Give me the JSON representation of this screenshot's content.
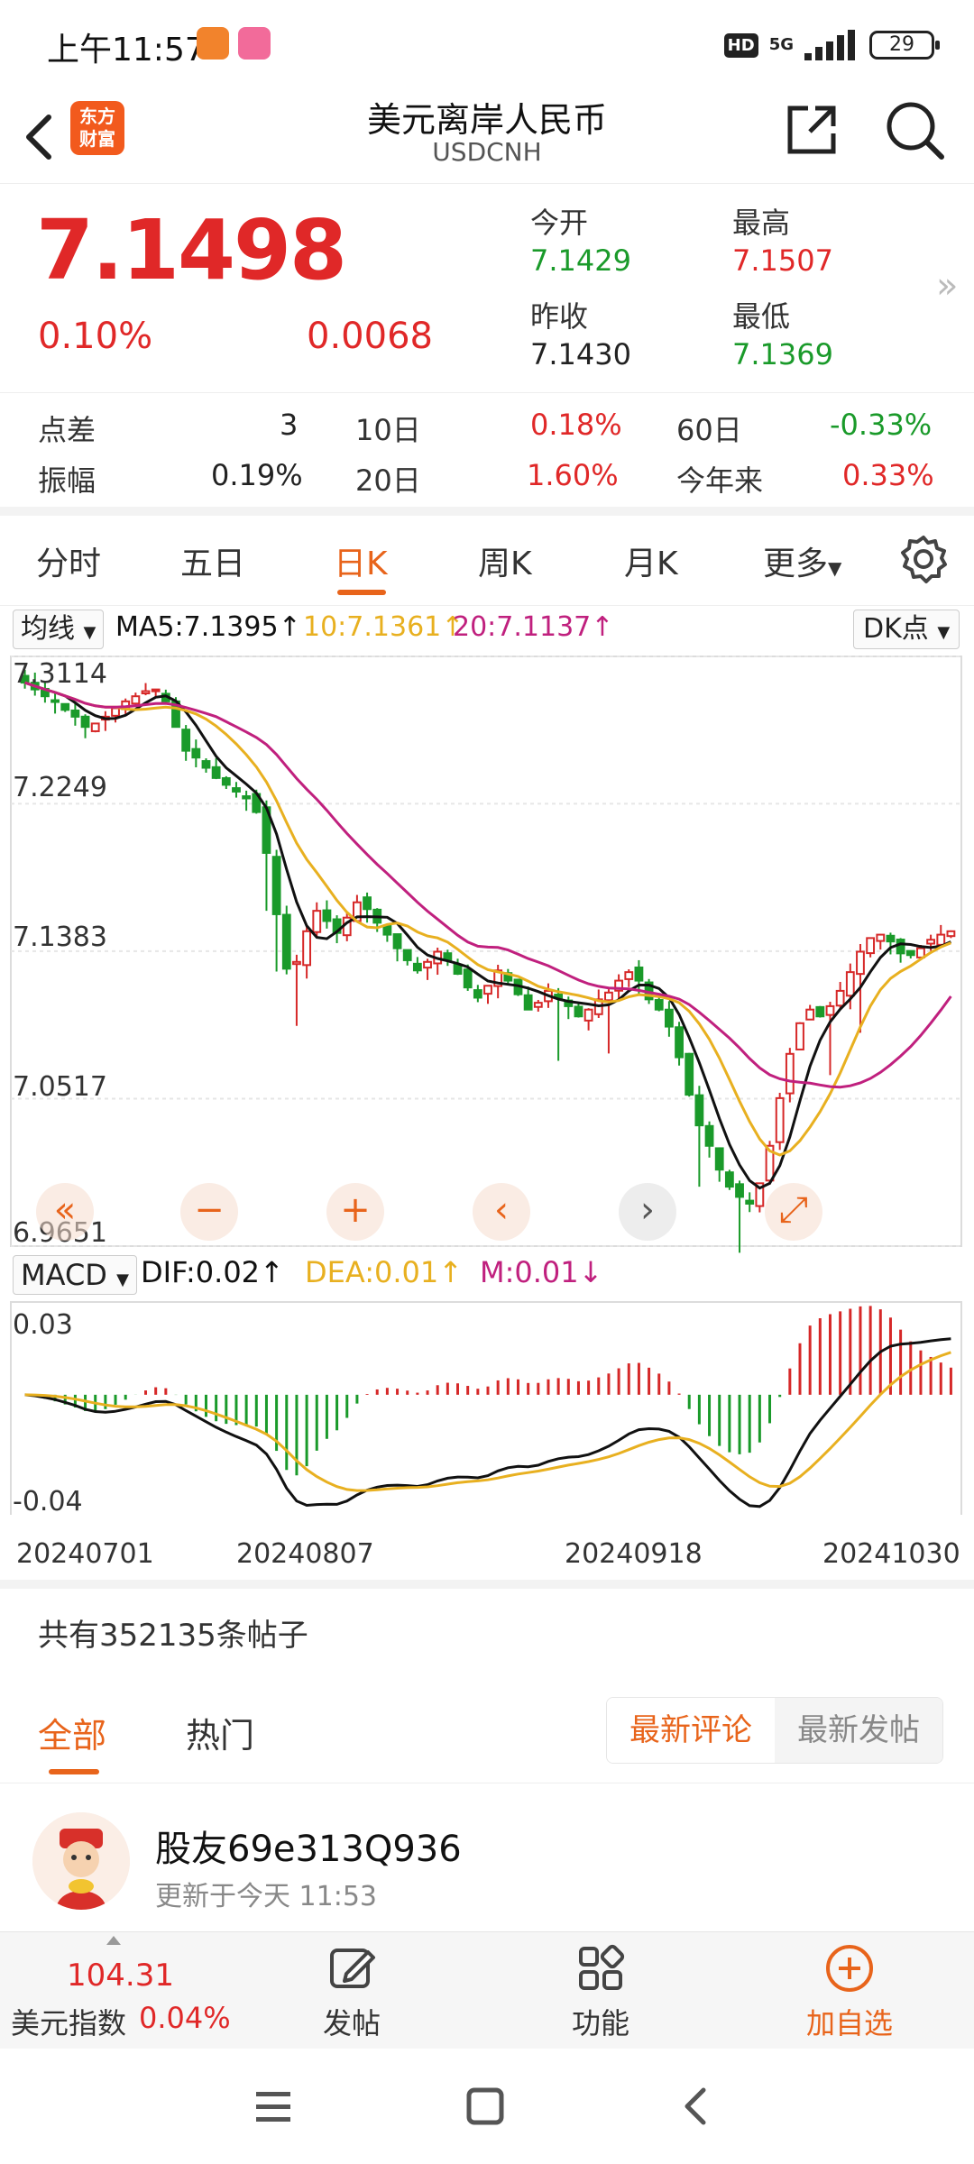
{
  "status": {
    "time": "上午11:57",
    "hd": "HD",
    "net": "5G",
    "battery": "29"
  },
  "nav": {
    "title": "美元离岸人民币",
    "subtitle": "USDCNH",
    "logo_line1": "东方",
    "logo_line2": "财富"
  },
  "quote": {
    "price": "7.1498",
    "change_pct": "0.10%",
    "change": "0.0068",
    "open_label": "今开",
    "open": "7.1429",
    "high_label": "最高",
    "high": "7.1507",
    "prev_close_label": "昨收",
    "prev_close": "7.1430",
    "low_label": "最低",
    "low": "7.1369"
  },
  "stats": {
    "spread_label": "点差",
    "spread": "3",
    "d10_label": "10日",
    "d10": "0.18%",
    "d60_label": "60日",
    "d60": "-0.33%",
    "amplitude_label": "振幅",
    "amplitude": "0.19%",
    "d20_label": "20日",
    "d20": "1.60%",
    "ytd_label": "今年来",
    "ytd": "0.33%"
  },
  "tabs": [
    "分时",
    "五日",
    "日K",
    "周K",
    "月K",
    "更多"
  ],
  "ma_bar": {
    "select": "均线",
    "ma5": "MA5:7.1395",
    "ma10": "10:7.1361",
    "ma20": "20:7.1137",
    "dk": "DK点"
  },
  "chart_data": {
    "type": "candlestick",
    "y_ticks": [
      "7.3114",
      "7.2249",
      "7.1383",
      "7.0517",
      "6.9651"
    ],
    "ylim": [
      6.9651,
      7.3114
    ],
    "x_ticks": [
      "20240701",
      "20240807",
      "20240918",
      "20241030"
    ],
    "close": [
      7.296,
      7.292,
      7.288,
      7.285,
      7.28,
      7.276,
      7.27,
      7.272,
      7.276,
      7.281,
      7.285,
      7.288,
      7.291,
      7.292,
      7.285,
      7.27,
      7.256,
      7.252,
      7.246,
      7.24,
      7.236,
      7.232,
      7.228,
      7.22,
      7.196,
      7.16,
      7.128,
      7.132,
      7.15,
      7.162,
      7.156,
      7.149,
      7.158,
      7.167,
      7.163,
      7.155,
      7.148,
      7.14,
      7.133,
      7.127,
      7.132,
      7.138,
      7.133,
      7.125,
      7.117,
      7.111,
      7.118,
      7.127,
      7.121,
      7.113,
      7.104,
      7.108,
      7.115,
      7.111,
      7.106,
      7.1,
      7.104,
      7.11,
      7.114,
      7.121,
      7.126,
      7.121,
      7.11,
      7.104,
      7.094,
      7.076,
      7.054,
      7.036,
      7.024,
      7.01,
      7.0,
      6.994,
      6.99,
      7.002,
      7.024,
      7.052,
      7.078,
      7.096,
      7.104,
      7.1,
      7.106,
      7.115,
      7.126,
      7.138,
      7.146,
      7.148,
      7.144,
      7.137,
      7.136,
      7.14,
      7.145,
      7.148,
      7.15
    ],
    "ma5_label": "MA5",
    "ma10_label": "10",
    "ma20_label": "20",
    "colors": {
      "up": "#d62828",
      "down": "#1a9a2a",
      "ma5": "#111111",
      "ma10": "#e8b020",
      "ma20": "#c0207e",
      "grid": "#e6e6e6"
    }
  },
  "chart_controls": [
    "«",
    "−",
    "+",
    "‹",
    "›",
    "⤢"
  ],
  "macd_bar": {
    "select": "MACD",
    "dif": "DIF:0.02",
    "dea": "DEA:0.01",
    "m": "M:0.01"
  },
  "macd": {
    "y_ticks": [
      "0.03",
      "-0.04"
    ],
    "ylim": [
      -0.04,
      0.03
    ]
  },
  "dates": [
    "20240701",
    "20240807",
    "20240918",
    "20241030"
  ],
  "posts": {
    "count_text": "共有352135条帖子",
    "tab_all": "全部",
    "tab_hot": "热门",
    "seg_latest_comment": "最新评论",
    "seg_latest_post": "最新发帖",
    "user": "股友69e313Q936",
    "updated": "更新于今天 11:53"
  },
  "bottom": {
    "index_val": "104.31",
    "index_name": "美元指数",
    "index_pct": "0.04%",
    "post": "发帖",
    "func": "功能",
    "add": "加自选"
  }
}
